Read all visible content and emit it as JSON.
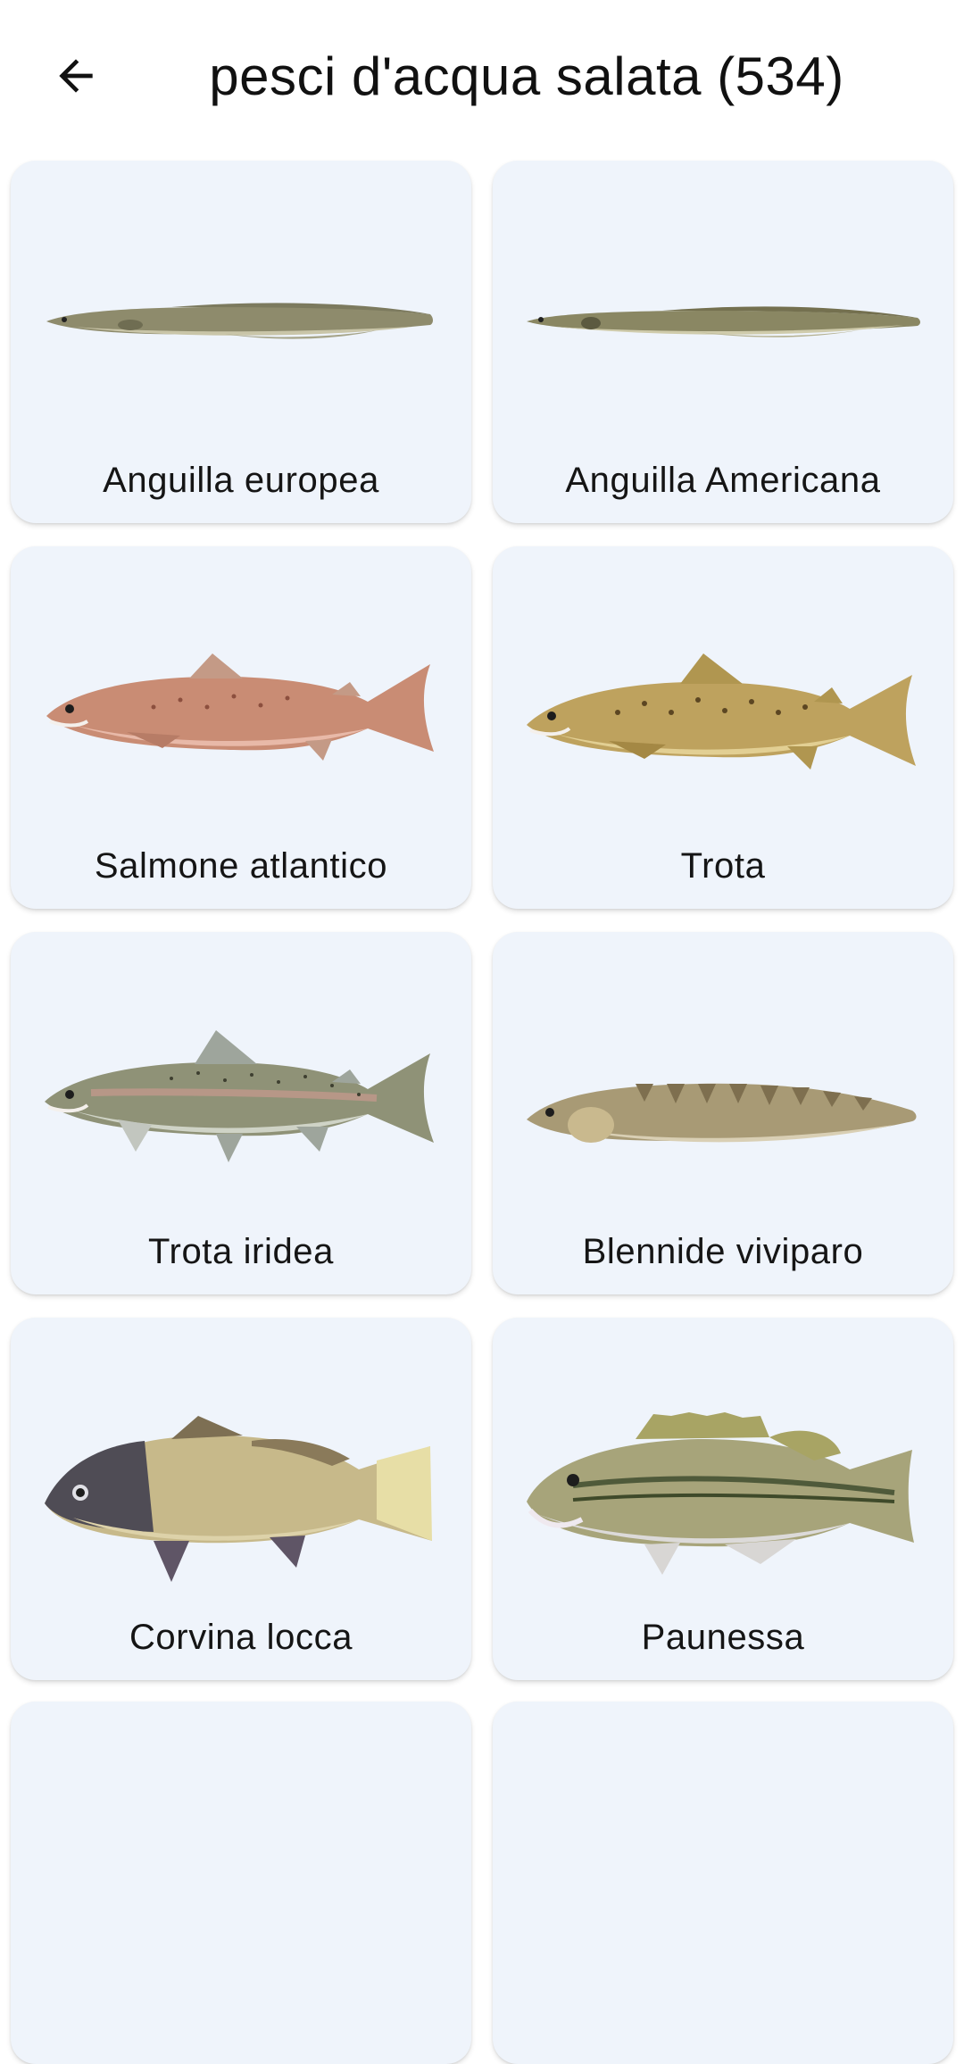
{
  "header": {
    "title": "pesci d'acqua salata (534)",
    "back_icon": "arrow-left-icon"
  },
  "fish": [
    {
      "name": "Anguilla europea",
      "image": "eel-illustration",
      "colors": {
        "body": "#8e8b6c",
        "belly": "#c9c5a8",
        "fin": "#7c7a5e"
      }
    },
    {
      "name": "Anguilla Americana",
      "image": "eel-illustration",
      "colors": {
        "body": "#8a8763",
        "belly": "#cfcbab",
        "fin": "#74704f"
      }
    },
    {
      "name": "Salmone atlantico",
      "image": "salmon-illustration",
      "colors": {
        "body": "#c98c74",
        "belly": "#e8b9a8",
        "fin": "#c49a86"
      }
    },
    {
      "name": "Trota",
      "image": "trout-illustration",
      "colors": {
        "body": "#bea25e",
        "belly": "#e2cf93",
        "fin": "#b09650"
      }
    },
    {
      "name": "Trota iridea",
      "image": "rainbow-trout-illustration",
      "colors": {
        "body": "#8f9277",
        "belly": "#cfd3c6",
        "fin": "#9ea59c"
      }
    },
    {
      "name": "Blennide viviparo",
      "image": "eelpout-illustration",
      "colors": {
        "body": "#a89a75",
        "belly": "#d9cfb4",
        "fin": "#7e6f4f"
      }
    },
    {
      "name": "Corvina locca",
      "image": "drum-fish-illustration",
      "colors": {
        "body": "#c7b98a",
        "belly": "#ddd2a9",
        "fin": "#7d6f53"
      }
    },
    {
      "name": "Paunessa",
      "image": "bass-illustration",
      "colors": {
        "body": "#a7a47a",
        "belly": "#dcdad9",
        "fin": "#a8a464"
      }
    }
  ]
}
